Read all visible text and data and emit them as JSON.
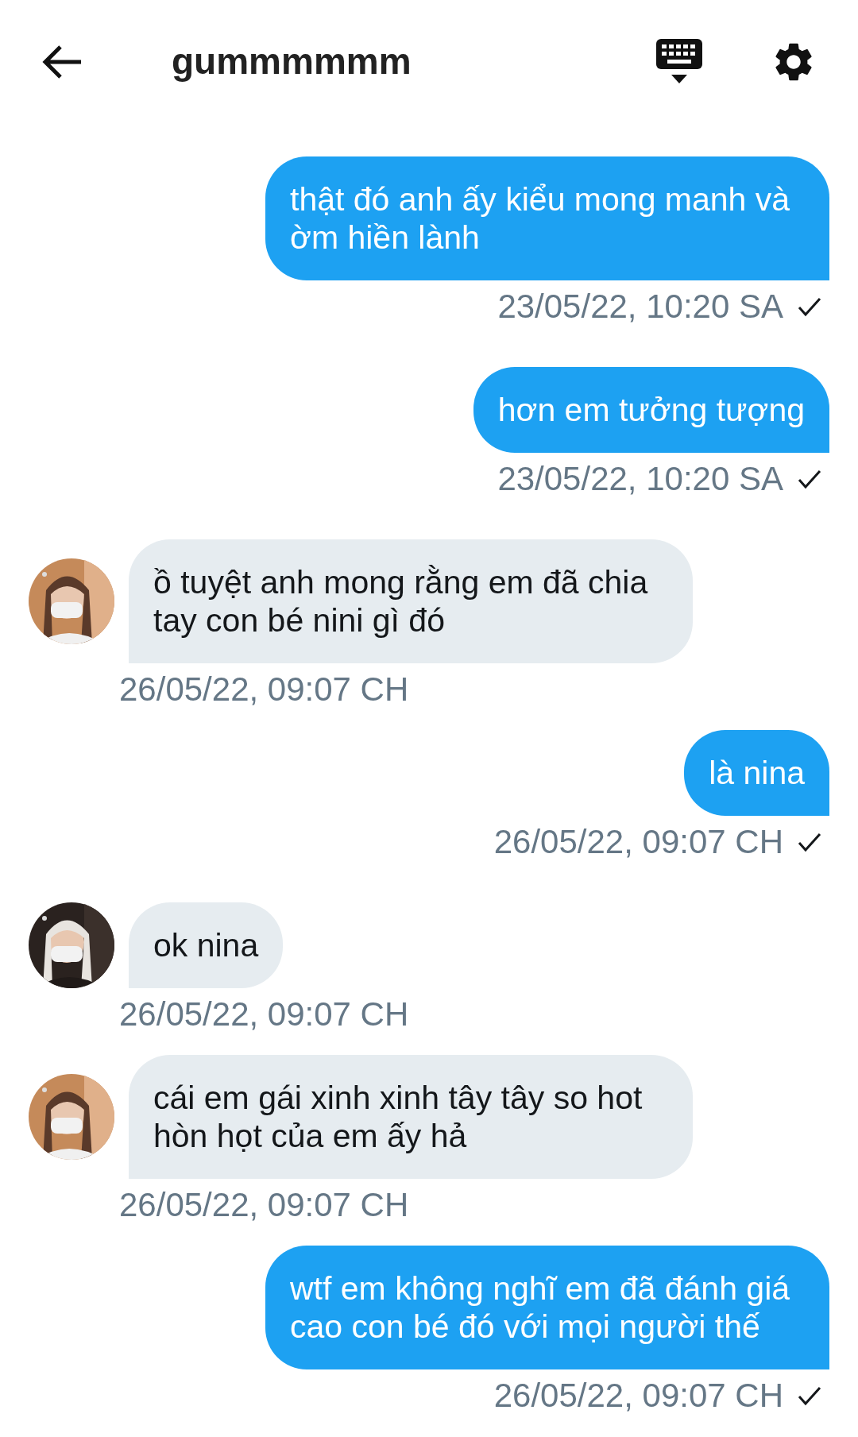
{
  "header": {
    "title": "gummmmmm"
  },
  "messages": [
    {
      "kind": "sent",
      "text": "thật đó anh ấy kiểu mong manh và ờm hiền lành",
      "time": "23/05/22, 10:20 SA"
    },
    {
      "kind": "sent",
      "text": "hơn em tưởng tượng",
      "time": "23/05/22, 10:20 SA"
    },
    {
      "kind": "received",
      "text": "ồ tuyệt anh mong rằng em đã chia tay con bé nini gì đó",
      "time": "26/05/22, 09:07 CH"
    },
    {
      "kind": "sent",
      "text": "là nina",
      "time": "26/05/22, 09:07 CH"
    },
    {
      "kind": "received",
      "text": "ok nina",
      "time": "26/05/22, 09:07 CH"
    },
    {
      "kind": "received",
      "text": "cái em gái xinh xinh tây tây so hot hòn họt của em ấy hả",
      "time": "26/05/22, 09:07 CH"
    },
    {
      "kind": "sent",
      "text": "wtf em không nghĩ em đã đánh giá cao con bé đó với mọi người thế",
      "time": "26/05/22, 09:07 CH"
    }
  ]
}
